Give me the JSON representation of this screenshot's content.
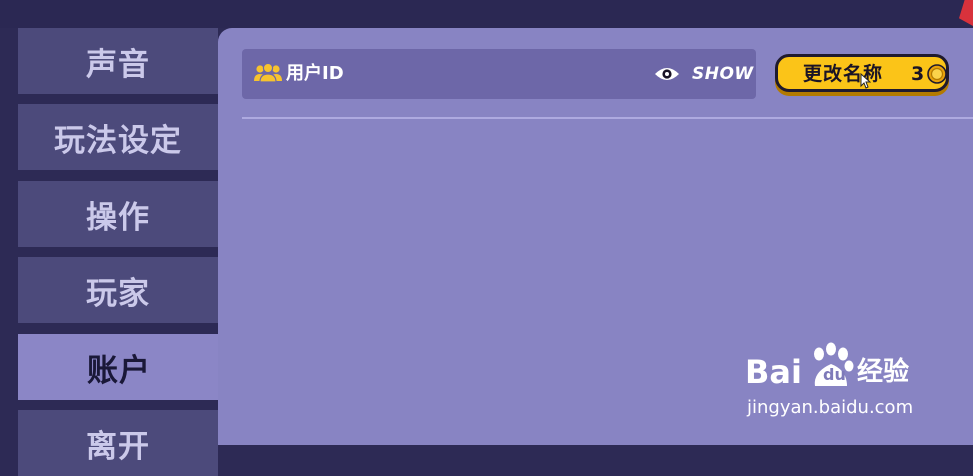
{
  "sidebar": {
    "items": [
      {
        "label": "声音",
        "active": false
      },
      {
        "label": "玩法设定",
        "active": false
      },
      {
        "label": "操作",
        "active": false
      },
      {
        "label": "玩家",
        "active": false
      },
      {
        "label": "账户",
        "active": true
      },
      {
        "label": "离开",
        "active": false
      }
    ]
  },
  "account": {
    "id_icon": "users-icon",
    "id_label": "用户ID",
    "show_icon": "eye-icon",
    "show_label": "SHOW",
    "rename": {
      "label": "更改名称",
      "cost": "3",
      "cost_icon": "coin-icon"
    }
  },
  "watermark": {
    "brand_left": "Bai",
    "brand_mid": "du",
    "brand_right": "经验",
    "url": "jingyan.baidu.com"
  },
  "colors": {
    "background": "#2d2a55",
    "sidebar_item": "#4c4a7b",
    "sidebar_active": "#8b86c6",
    "panel": "#8884c3",
    "id_row": "#6d67a8",
    "button": "#fbc418",
    "icon_accent": "#f7c32e"
  }
}
